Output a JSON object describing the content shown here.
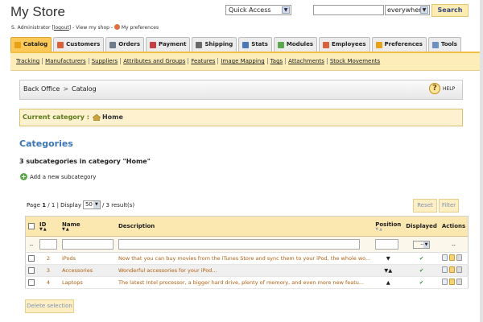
{
  "header": {
    "store_title": "My Store",
    "quick_access": "Quick Access",
    "search_value": "",
    "search_scope": "everywhere",
    "search_button": "Search",
    "user_name": "S. Administrator",
    "logout": "logout",
    "view_shop": "View my shop",
    "preferences": "My preferences"
  },
  "tabs": [
    {
      "label": "Catalog",
      "color": "#e7a21a",
      "active": true
    },
    {
      "label": "Customers",
      "color": "#d9613b"
    },
    {
      "label": "Orders",
      "color": "#6d7b8c"
    },
    {
      "label": "Payment",
      "color": "#c14242"
    },
    {
      "label": "Shipping",
      "color": "#6a6a6a"
    },
    {
      "label": "Stats",
      "color": "#4b79b8"
    },
    {
      "label": "Modules",
      "color": "#5aa94a"
    },
    {
      "label": "Employees",
      "color": "#d9613b"
    },
    {
      "label": "Preferences",
      "color": "#e7a21a"
    },
    {
      "label": "Tools",
      "color": "#6d8fc2"
    }
  ],
  "subnav": [
    "Tracking",
    "Manufacturers",
    "Suppliers",
    "Attributes and Groups",
    "Features",
    "Image Mapping",
    "Tags",
    "Attachments",
    "Stock Movements"
  ],
  "breadcrumb": {
    "root": "Back Office",
    "sep": ">",
    "current": "Catalog"
  },
  "help_label": "HELP",
  "current_category": {
    "label": "Current category :",
    "value": "Home"
  },
  "categories_heading": "Categories",
  "subcategory_count": "3 subcategories in category \"Home\"",
  "add_subcategory": "Add a new subcategory",
  "pager": {
    "page": "Page",
    "page_num": "1",
    "page_of": "/ 1",
    "display": "| Display",
    "per_page": "50",
    "results": "/ 3 result(s)"
  },
  "reset_button": "Reset",
  "filter_button": "Filter",
  "table": {
    "headers": {
      "id": "ID",
      "name": "Name",
      "description": "Description",
      "position": "Position",
      "displayed": "Displayed",
      "actions": "Actions"
    },
    "filter_placeholder": "--",
    "filter_actions": "--",
    "rows": [
      {
        "id": "2",
        "name": "iPods",
        "description": "Now that you can buy movies from the iTunes Store and sync them to your iPod, the whole wo...",
        "position": "▼",
        "displayed": "✔"
      },
      {
        "id": "3",
        "name": "Accessories",
        "description": "Wonderful accessories for your iPod...",
        "position": "▼▲",
        "displayed": "✔"
      },
      {
        "id": "4",
        "name": "Laptops",
        "description": "The latest Intel processor, a bigger hard drive, plenty of memory, and even more new featu...",
        "position": "▲",
        "displayed": "✔"
      }
    ]
  },
  "delete_selection": "Delete selection"
}
